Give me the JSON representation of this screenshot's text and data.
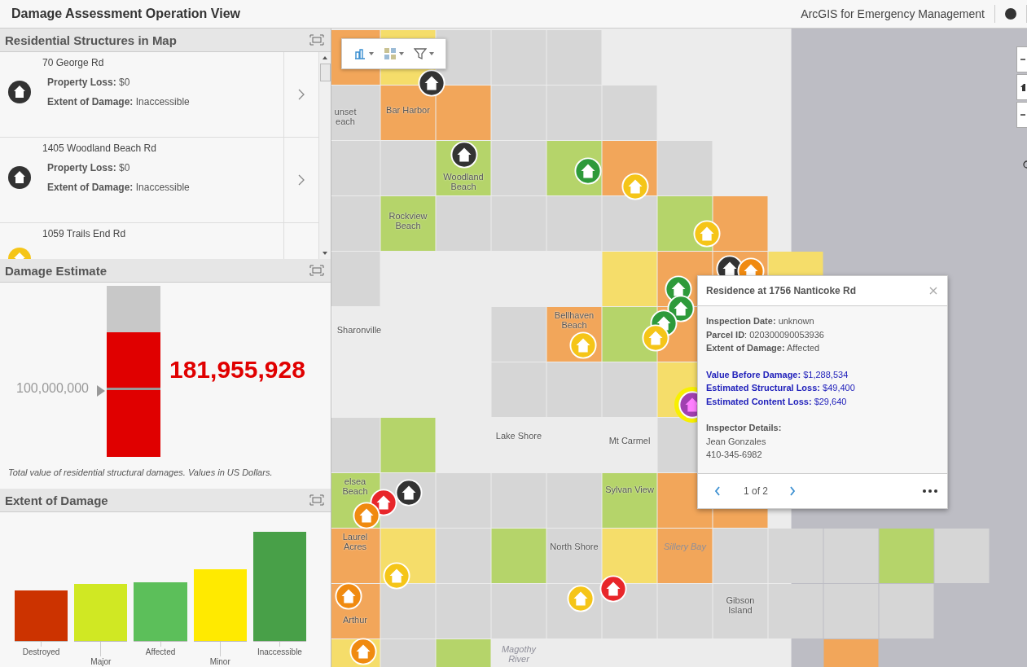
{
  "header": {
    "title": "Damage Assessment Operation View",
    "product": "ArcGIS for Emergency Management"
  },
  "structures_panel": {
    "title": "Residential Structures in Map",
    "items": [
      {
        "address": "70 George Rd",
        "loss": "**Property Loss:** $0",
        "extent": "**Extent of Damage:** Inaccessible",
        "color": "#333333"
      },
      {
        "address": "1405 Woodland Beach Rd",
        "loss": "**Property Loss:** $0",
        "extent": "**Extent of Damage:** Inaccessible",
        "color": "#333333"
      },
      {
        "address": "1059 Trails End Rd",
        "color": "#f5c518"
      }
    ]
  },
  "estimate_panel": {
    "title": "Damage Estimate",
    "level": 0.73,
    "target": "100,000,000",
    "value": "181,955,928",
    "note": "Total value of residential structural damages. Values in US Dollars."
  },
  "extent_panel": {
    "title": "Extent of Damage",
    "categories": [
      {
        "label": "Destroyed",
        "color": "#cc3300"
      },
      {
        "label": "Major",
        "color": "#d0e823"
      },
      {
        "label": "Affected",
        "color": "#5cbf5a"
      },
      {
        "label": "Minor",
        "color": "#ffea00"
      },
      {
        "label": "Inaccessible",
        "color": "#48a048"
      }
    ]
  },
  "map": {
    "places": [
      {
        "name": "unset each",
        "kind": "town"
      },
      {
        "name": "Bar Harbor",
        "kind": "town"
      },
      {
        "name": "Woodland Beach",
        "kind": "town"
      },
      {
        "name": "Rockview Beach",
        "kind": "town"
      },
      {
        "name": "Bellhaven Beach",
        "kind": "town"
      },
      {
        "name": "Sharonville",
        "kind": "town"
      },
      {
        "name": "Lake Shore",
        "kind": "town"
      },
      {
        "name": "Mt Carmel",
        "kind": "town"
      },
      {
        "name": "elsea Beach",
        "kind": "town"
      },
      {
        "name": "Laurel Acres",
        "kind": "town"
      },
      {
        "name": "Sylvan View",
        "kind": "town"
      },
      {
        "name": "North Shore",
        "kind": "town"
      },
      {
        "name": "Gibson Island",
        "kind": "town"
      },
      {
        "name": "Arthur",
        "kind": "town"
      },
      {
        "name": "Sillery Bay",
        "kind": "water"
      },
      {
        "name": "Magothy River",
        "kind": "water"
      }
    ]
  },
  "popup": {
    "title": "Residence at 1756 Nanticoke Rd",
    "pager": "1 of 2",
    "sections": [
      {
        "kind": "info",
        "lines": [
          {
            "text": "**Inspection Date:** unknown",
            "kind": "plain"
          },
          {
            "text": "**Parcel ID**: 020300090053936",
            "kind": "plain"
          },
          {
            "text": "**Extent of Damage:** Affected",
            "kind": "plain"
          }
        ]
      },
      {
        "kind": "values",
        "lines": [
          {
            "text": "**Value Before Damage:** $1,288,534",
            "kind": "plain"
          },
          {
            "text": "**Estimated Structural Loss:** $49,400",
            "kind": "plain"
          },
          {
            "text": "**Estimated Content Loss:** $29,640",
            "kind": "plain"
          }
        ]
      },
      {
        "kind": "info",
        "lines": [
          {
            "text": "Inspector Details:",
            "kind": "heading"
          },
          {
            "text": "Jean Gonzales",
            "kind": "plain"
          },
          {
            "text": "410-345-6982",
            "kind": "plain"
          }
        ]
      }
    ]
  }
}
